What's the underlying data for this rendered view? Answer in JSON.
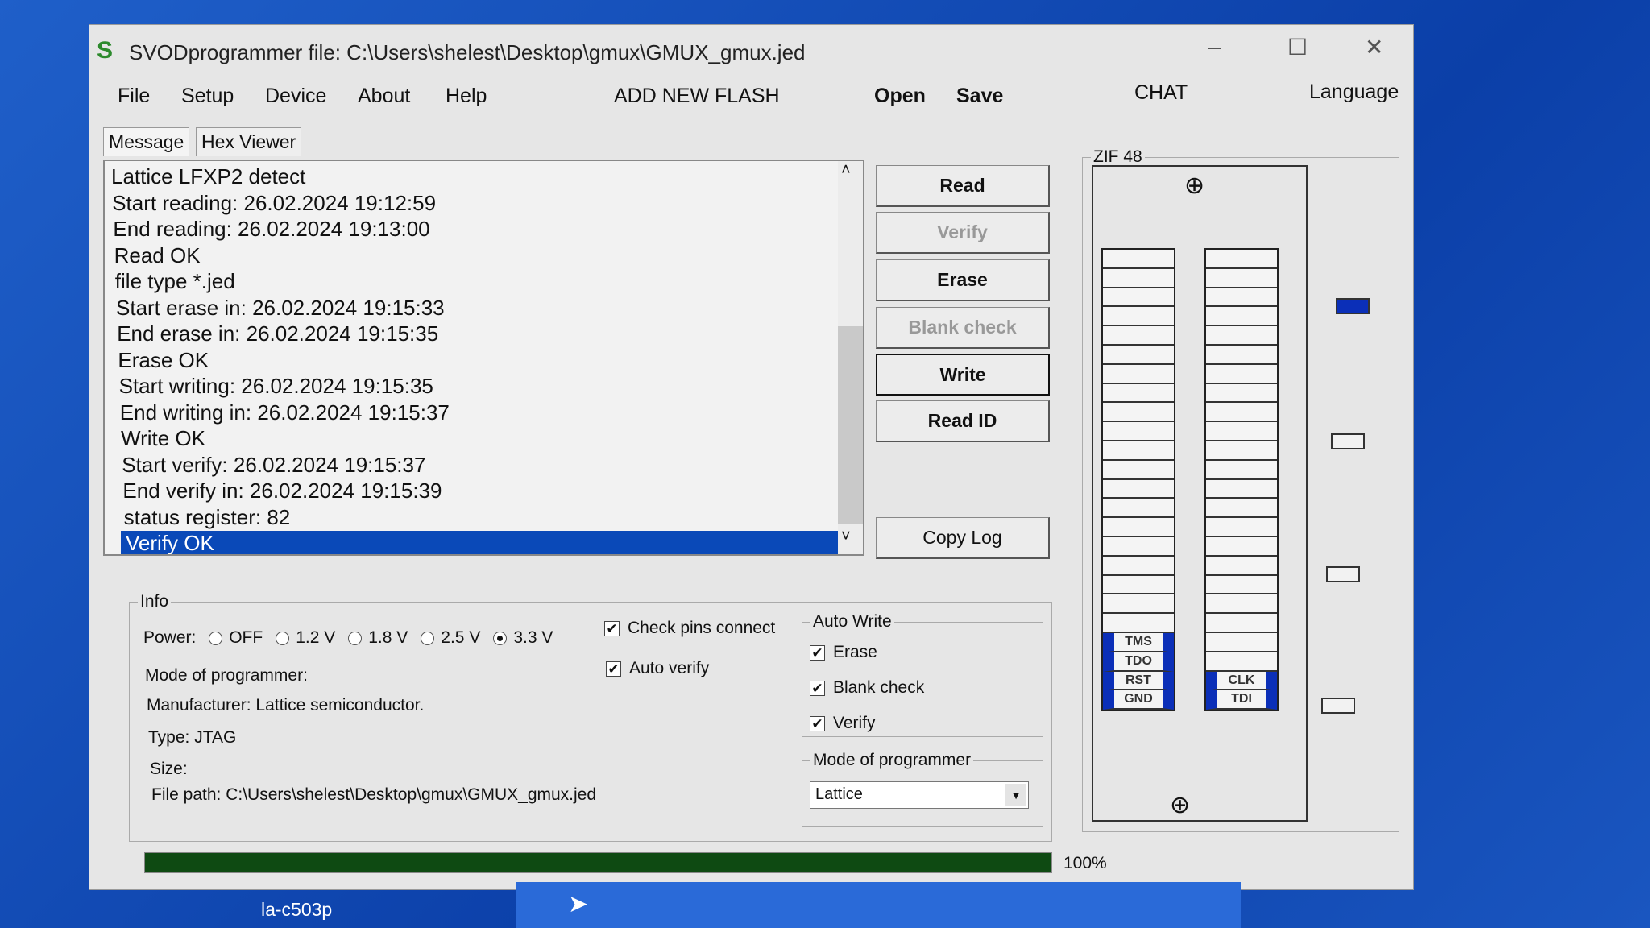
{
  "window": {
    "title": "SVODprogrammer file: C:\\Users\\shelest\\Desktop\\gmux\\GMUX_gmux.jed",
    "logo": "S"
  },
  "menu": [
    "File",
    "Setup",
    "Device",
    "About",
    "Help",
    "ADD NEW FLASH",
    "Open",
    "Save",
    "CHAT",
    "Language"
  ],
  "tabs": [
    "Message",
    "Hex Viewer"
  ],
  "log": [
    "Lattice LFXP2 detect",
    "Start reading: 26.02.2024 19:12:59",
    "End reading: 26.02.2024 19:13:00",
    "Read OK",
    "file type *.jed",
    "Start erase in: 26.02.2024 19:15:33",
    "End erase in: 26.02.2024 19:15:35",
    "Erase OK",
    "Start writing: 26.02.2024 19:15:35",
    "End writing in: 26.02.2024 19:15:37",
    "Write OK",
    "Start verify: 26.02.2024 19:15:37",
    "End verify in: 26.02.2024 19:15:39",
    "status register: 82",
    "Verify OK"
  ],
  "buttons": {
    "read": "Read",
    "verify": "Verify",
    "erase": "Erase",
    "blank": "Blank check",
    "write": "Write",
    "readid": "Read ID",
    "copylog": "Copy Log"
  },
  "info": {
    "legend": "Info",
    "power_label": "Power:",
    "power_options": [
      "OFF",
      "1.2 V",
      "1.8 V",
      "2.5 V",
      "3.3 V"
    ],
    "power_selected": "3.3 V",
    "check_pins": "Check pins connect",
    "auto_verify": "Auto verify",
    "mode": "Mode of programmer:",
    "manufacturer": "Manufacturer: Lattice semiconductor.",
    "type": "Type: JTAG",
    "size": "Size:",
    "file_path": "File path: C:\\Users\\shelest\\Desktop\\gmux\\GMUX_gmux.jed"
  },
  "autowrite": {
    "legend": "Auto Write",
    "erase": "Erase",
    "blank": "Blank check",
    "verify": "Verify"
  },
  "mode_group": {
    "legend": "Mode of programmer",
    "value": "Lattice"
  },
  "zif": {
    "legend": "ZIF 48",
    "left_pins": [
      "TMS",
      "TDO",
      "RST",
      "GND"
    ],
    "right_pins": [
      "CLK",
      "TDI"
    ]
  },
  "progress": {
    "value": 100,
    "label": "100%",
    "color": "#0e4a12"
  },
  "desktop": {
    "label": "la-c503p"
  },
  "colors": {
    "accent": "#0a49b8"
  }
}
